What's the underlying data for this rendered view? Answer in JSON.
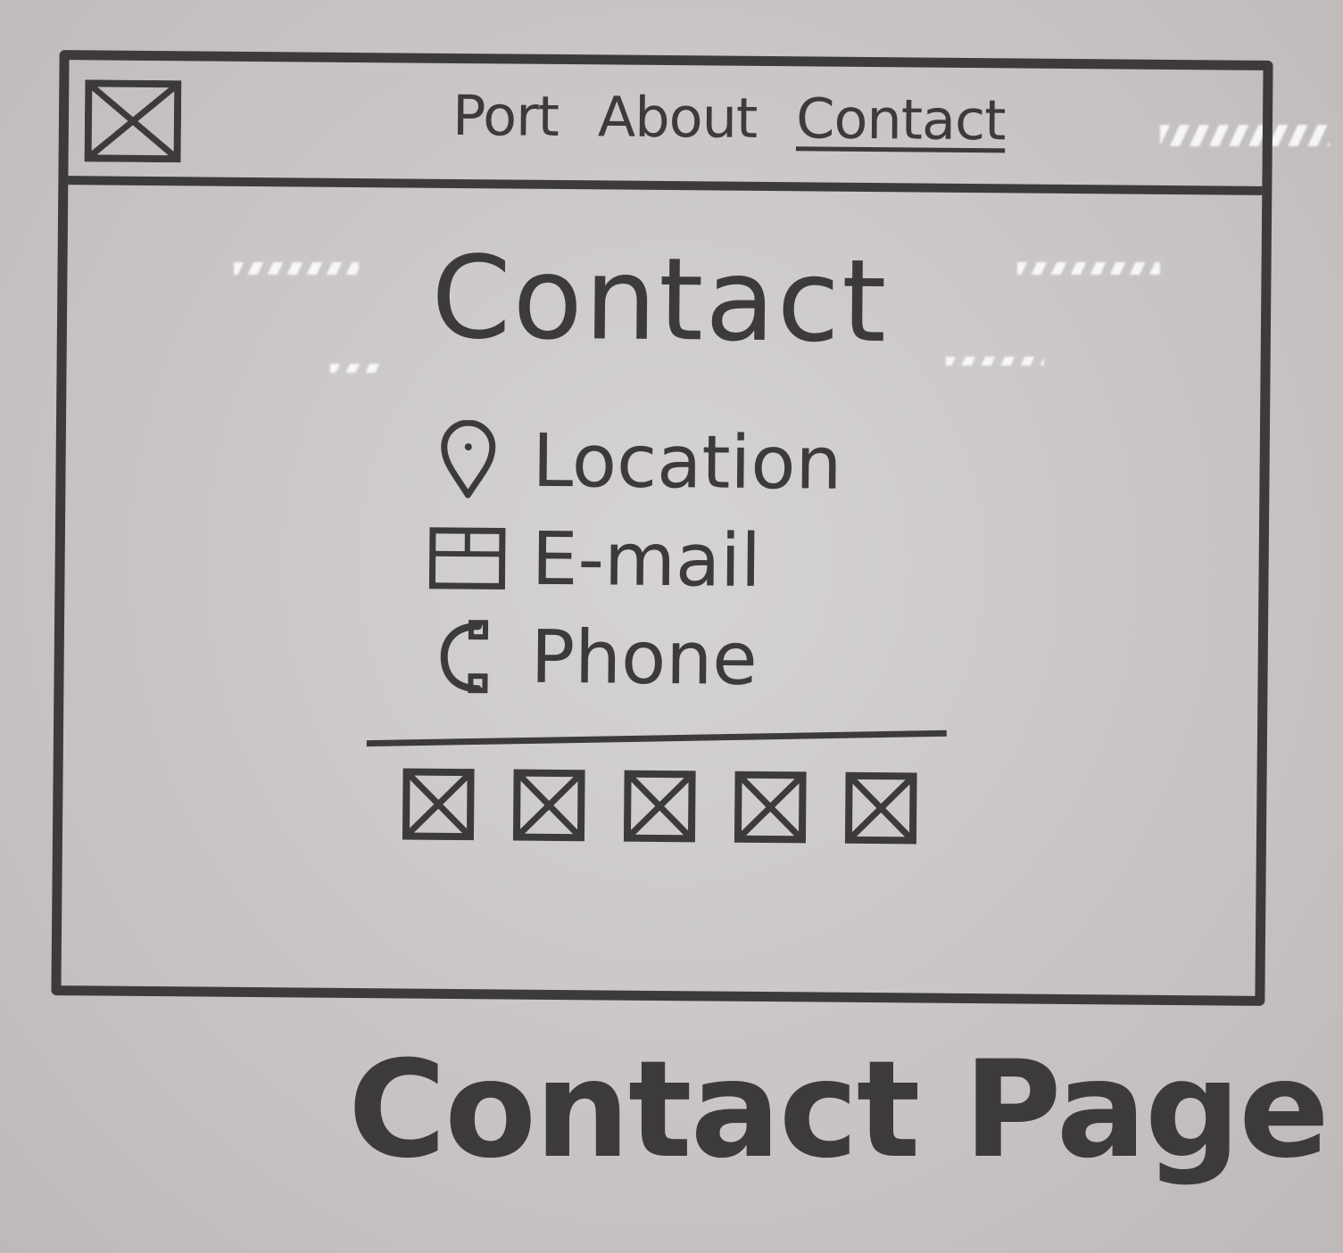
{
  "nav": {
    "logo_icon": "logo-placeholder-icon",
    "links": [
      {
        "label": "Port"
      },
      {
        "label": "About"
      },
      {
        "label": "Contact",
        "active": true
      }
    ]
  },
  "main": {
    "title": "Contact",
    "contact_items": [
      {
        "icon": "location-pin-icon",
        "label": "Location"
      },
      {
        "icon": "mail-icon",
        "label": "E-mail"
      },
      {
        "icon": "phone-icon",
        "label": "Phone"
      }
    ],
    "social_icons": [
      "image-placeholder-icon",
      "image-placeholder-icon",
      "image-placeholder-icon",
      "image-placeholder-icon",
      "image-placeholder-icon"
    ]
  },
  "caption": "Contact Page",
  "colors": {
    "ink": "#3d3a3a",
    "board": "#d6d3d3"
  }
}
